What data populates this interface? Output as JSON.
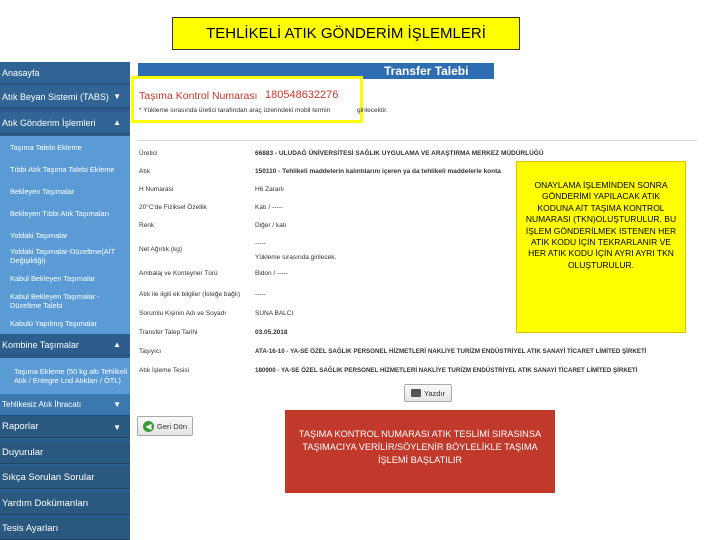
{
  "slide_title": "TEHLİKELİ ATIK GÖNDERİM İŞLEMLERİ",
  "sidebar": {
    "top_items": [
      {
        "label": "Anasayfa"
      },
      {
        "label": "Atık Beyan Sistemi (TABS)"
      },
      {
        "label": "Atık Gönderim İşlemleri"
      }
    ],
    "sub_items": [
      {
        "label": "Taşıma Talebi Ekleme"
      },
      {
        "label": "Tıbbi Atık Taşıma Talebi Ekleme"
      },
      {
        "label": "Bekleyen Taşımalar"
      },
      {
        "label": "Bekleyen Tıbbi Atık Taşımaları"
      },
      {
        "label": "Yoldaki Taşımalar"
      },
      {
        "label": "Yoldaki Taşımalar-Düzeltme(AİT Değişikliği)"
      },
      {
        "label": "Kabul Bekleyen Taşımalar"
      },
      {
        "label": "Kabul Bekleyen Taşımalar - Düzeltme Talebi"
      },
      {
        "label": "Kabulü Yapılmış Taşımalar"
      }
    ],
    "kombine": {
      "label": "Kombine Taşımalar"
    },
    "kombine_sub": {
      "label": "Taşıma Ekleme (50 kg altı Tehlikeli Atık / Entegre Lnd Atıkları / ÖTL)"
    },
    "tehlikesiz": {
      "label": "Tehlikesiz Atık İhracatı"
    },
    "bottom_items": [
      {
        "label": "Raporlar"
      },
      {
        "label": "Duyurular"
      },
      {
        "label": "Sıkça Sorulan Sorular"
      },
      {
        "label": "Yardım Dokümanları"
      },
      {
        "label": "Tesis Ayarları"
      }
    ]
  },
  "panel": {
    "title": "Transfer Talebi",
    "tkn_label": "Taşıma Kontrol Numarası",
    "tkn_value": "180548632276",
    "tkn_note": "* Yükleme sırasında üretici tarafından araç üzerindeki mobil termin",
    "tkn_note_cont": "girilecektir."
  },
  "fields": [
    {
      "label": "Üretici",
      "value": "66883 - ULUDAĞ ÜNİVERSİTESİ SAĞLIK UYGULAMA VE ARAŞTIRMA MERKEZ MÜDÜRLÜĞÜ"
    },
    {
      "label": "Atık",
      "value": "150110 - Tehlikeli maddelerin kalıntılarını içeren ya da tehlikeli maddelerle konta"
    },
    {
      "label": "H Numarası",
      "value": "H6 Zararlı"
    },
    {
      "label": "20°C'de Fiziksel Özellik",
      "value": "Katı / -----"
    },
    {
      "label": "Renk",
      "value": "Diğer / katı"
    },
    {
      "label": "",
      "value": "-----"
    },
    {
      "label": "Net Ağırlık (kg)",
      "value": "Yükleme sırasında girilecek."
    },
    {
      "label": "Ambalaj ve Konteyner Türü",
      "value": "Bidon / -----"
    },
    {
      "label": "Atık ile ilgili ek bilgiler (İsteğe bağlı)",
      "value": "-----"
    },
    {
      "label": "Sorumlu Kişinin Adı ve Soyadı",
      "value": "SUNA BALCI"
    },
    {
      "label": "Transfer Talep Tarihi",
      "value": "03.05.2018"
    },
    {
      "label": "Taşıyıcı",
      "value": "ATA-16-10 - YA-SE ÖZEL SAĞLIK PERSONEL HİZMETLERİ NAKLİYE TURİZM ENDÜSTRİYEL ATIK SANAYİ TİCARET LİMİTED ŞİRKETİ"
    },
    {
      "label": "Atık İşleme Tesisi",
      "value": "180900 - YA-SE ÖZEL SAĞLIK PERSONEL HİZMETLERİ NAKLİYE TURİZM ENDÜSTRİYEL ATIK SANAYİ TİCARET LİMİTED ŞİRKETİ"
    }
  ],
  "buttons": {
    "print": "Yazdır",
    "back": "Geri Dön"
  },
  "notes": {
    "yellow": "ONAYLAMA İŞLEMİNDEN SONRA GÖNDERİMİ YAPILACAK ATIK KODUNA AİT TAŞIMA KONTROL NUMARASI (TKN)OLUŞTURULUR. BU İŞLEM GÖNDERİLMEK İSTENEN HER ATIK KODU İÇİN TEKRARLANIR VE HER ATIK KODU İÇİN AYRI AYRI TKN OLUŞTURULUR.",
    "red": "TAŞIMA KONTROL NUMARASI ATIK TESLİMİ SIRASINSA TAŞIMACIYA VERİLİR/SÖYLENİR BÖYLELİKLE TAŞIMA İŞLEMİ BAŞLATILIR"
  },
  "colors": {
    "sidebar": "#2c5d8c",
    "submenu": "#5b9bd5",
    "header": "#2f6db3",
    "highlight": "#ffff00",
    "red_note": "#c0392b",
    "tkn": "#c0392b"
  }
}
